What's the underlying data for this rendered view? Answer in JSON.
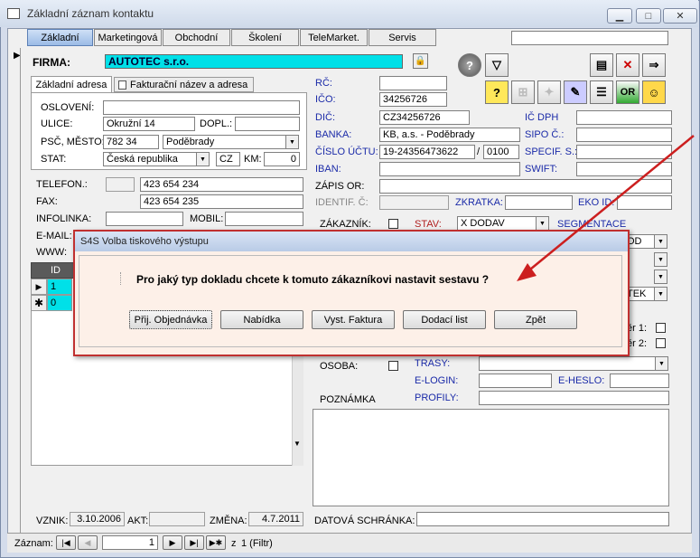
{
  "window": {
    "title": "Základní záznam kontaktu",
    "min": "▭",
    "max": "□",
    "close": "✕"
  },
  "tabs": [
    "Základní",
    "Marketingová",
    "Obchodní",
    "Školení",
    "TeleMarket.",
    "Servis"
  ],
  "firma": {
    "label": "FIRMA:",
    "value": "AUTOTEC s.r.o."
  },
  "subtabs": [
    "Základní adresa",
    "Fakturační název a adresa"
  ],
  "address": {
    "osloveni_label": "OSLOVENÍ:",
    "osloveni": "",
    "ulice_label": "ULICE:",
    "ulice": "Okružní 14",
    "dopl_label": "DOPL.:",
    "dopl": "",
    "psc_label": "PSČ, MĚSTO:",
    "psc": "782 34",
    "mesto": "Poděbrady",
    "stat_label": "STAT:",
    "stat": "Česká republika",
    "stat_code": "CZ",
    "km_label": "KM:",
    "km": "0"
  },
  "contacts": {
    "telefon_label": "TELEFON.:",
    "telefon": "423 654 234",
    "fax_label": "FAX:",
    "fax": "423 654 235",
    "infolinka_label": "INFOLINKA:",
    "mobil_label": "MOBIL:",
    "email_label": "E-MAIL:",
    "www_label": "WWW:"
  },
  "grid": {
    "header": "ID",
    "rows": [
      "1",
      "0"
    ]
  },
  "right": {
    "rc_label": "RČ:",
    "rc": "",
    "ico_label": "IČO:",
    "ico": "34256726",
    "dic_label": "DIČ:",
    "dic": "CZ34256726",
    "icdph_label": "IČ DPH",
    "banka_label": "BANKA:",
    "banka": "KB, a.s. - Poděbrady",
    "sipo_label": "SIPO Č.:",
    "ucet_label": "ČÍSLO ÚČTU:",
    "ucet": "19-24356473622",
    "slash": "/",
    "kod": "0100",
    "specif_label": "SPECIF. S.:",
    "iban_label": "IBAN:",
    "swift_label": "SWIFT:",
    "zapis_label": "ZÁPIS OR:",
    "identif_label": "IDENTIF. Č:",
    "zkratka_label": "ZKRATKA:",
    "eko_label": "EKO ID:",
    "zakaznik_label": "ZÁKAZNÍK:",
    "stav_label": "STAV:",
    "stav": "X DODAV",
    "segmentace_label": "SEGMENTACE",
    "dd_partial": "OD",
    "tek_partial": "TEK",
    "vyber1": "ěr 1:",
    "vyber2": "ěr 2:",
    "osoba_label": "OSOBA:",
    "trasy_label": "TRASY:",
    "elogin_label": "E-LOGIN:",
    "eheslo_label": "E-HESLO:",
    "profily_label": "PROFILY:",
    "poznamka_label": "POZNÁMKA",
    "datova_label": "DATOVÁ SCHRÁNKA:"
  },
  "footer": {
    "vznik_label": "VZNIK:",
    "vznik": "3.10.2006",
    "akt_label": "AKT:",
    "zmena_label": "ZMĚNA:",
    "zmena": "4.7.2011"
  },
  "nav": {
    "label": "Záznam:",
    "record": "1",
    "of": "z",
    "total": "1 (Filtr)"
  },
  "dialog": {
    "title": "S4S Volba tiskového výstupu",
    "question": "Pro jaký typ dokladu chcete k tomuto zákazníkovi nastavit sestavu ?",
    "buttons": [
      "Přij. Objednávka",
      "Nabídka",
      "Vyst. Faktura",
      "Dodací list",
      "Zpět"
    ]
  },
  "colors": {
    "firma_bg": "#00e0e8",
    "dialog_border": "#c03030",
    "arrow": "#cc1f1f"
  }
}
